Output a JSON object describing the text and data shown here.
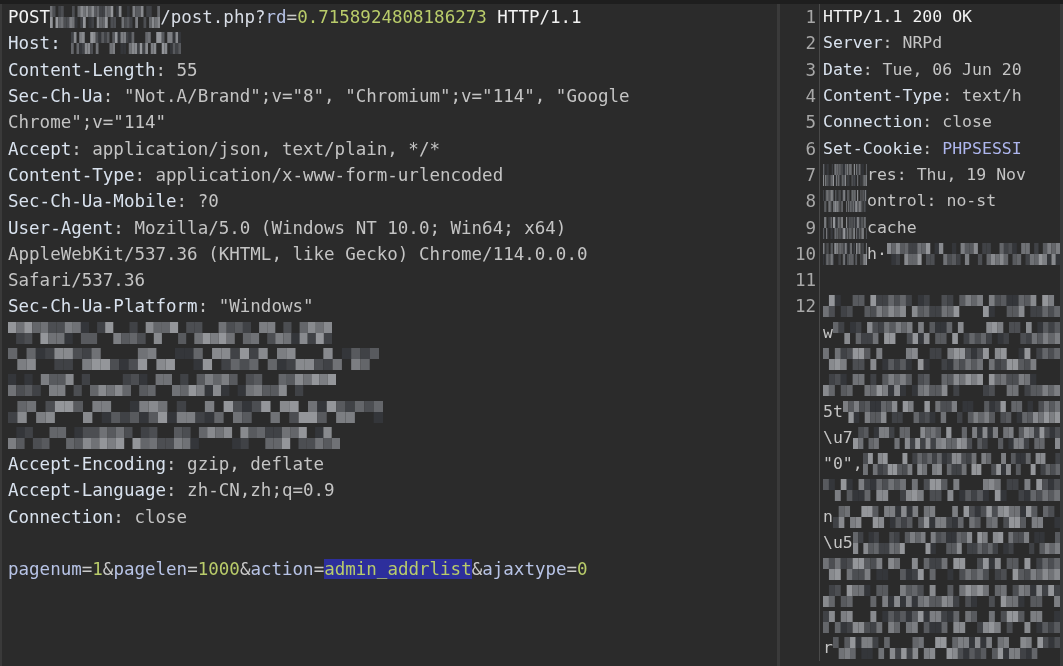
{
  "request": {
    "lines": [
      {
        "kind": "code",
        "segments": [
          {
            "t": "POST",
            "kind": "method"
          },
          {
            "kind": "redacted"
          },
          {
            "t": "/post.php?",
            "kind": "path"
          },
          {
            "t": "rd",
            "kind": "param"
          },
          {
            "t": "=",
            "kind": "plain"
          },
          {
            "t": "0.7158924808186273",
            "kind": "number"
          },
          {
            "t": " HTTP/1.1",
            "kind": "method"
          }
        ]
      },
      {
        "kind": "code",
        "segments": [
          {
            "t": "Host: ",
            "kind": "name"
          },
          {
            "kind": "redacted"
          }
        ]
      },
      {
        "kind": "code",
        "segments": [
          {
            "t": "Content-Length",
            "kind": "name"
          },
          {
            "t": ": 55",
            "kind": "value"
          }
        ]
      },
      {
        "kind": "code",
        "segments": [
          {
            "t": "Sec-Ch-Ua",
            "kind": "name"
          },
          {
            "t": ": \"Not.A/Brand\";v=\"8\", \"Chromium\";v=\"114\", \"Google",
            "kind": "value"
          }
        ]
      },
      {
        "kind": "code",
        "segments": [
          {
            "t": "Chrome\";v=\"114\"",
            "kind": "value"
          }
        ]
      },
      {
        "kind": "code",
        "segments": [
          {
            "t": "Accept",
            "kind": "name"
          },
          {
            "t": ": application/json, text/plain, */*",
            "kind": "value"
          }
        ]
      },
      {
        "kind": "code",
        "segments": [
          {
            "t": "Content-Type",
            "kind": "name"
          },
          {
            "t": ": application/x-www-form-urlencoded",
            "kind": "value"
          }
        ]
      },
      {
        "kind": "code",
        "segments": [
          {
            "t": "Sec-Ch-Ua-Mobile",
            "kind": "name"
          },
          {
            "t": ": ?0",
            "kind": "value"
          }
        ]
      },
      {
        "kind": "code",
        "segments": [
          {
            "t": "User-Agent",
            "kind": "name"
          },
          {
            "t": ": Mozilla/5.0 (Windows NT 10.0; Win64; x64)",
            "kind": "value"
          }
        ]
      },
      {
        "kind": "code",
        "segments": [
          {
            "t": "AppleWebKit/537.36 (KHTML, like Gecko) Chrome/114.0.0.0",
            "kind": "value"
          }
        ]
      },
      {
        "kind": "code",
        "segments": [
          {
            "t": "Safari/537.36",
            "kind": "value"
          }
        ]
      },
      {
        "kind": "code",
        "segments": [
          {
            "t": "Sec-Ch-Ua-Platform",
            "kind": "name"
          },
          {
            "t": ": \"Windows\"",
            "kind": "value"
          }
        ]
      },
      {
        "kind": "redacted"
      },
      {
        "kind": "redacted"
      },
      {
        "kind": "redacted"
      },
      {
        "kind": "redacted"
      },
      {
        "kind": "redacted"
      },
      {
        "kind": "code",
        "segments": [
          {
            "t": "Accept-Encoding",
            "kind": "name"
          },
          {
            "t": ": gzip, deflate",
            "kind": "value"
          }
        ]
      },
      {
        "kind": "code",
        "segments": [
          {
            "t": "Accept-Language",
            "kind": "name"
          },
          {
            "t": ": zh-CN,zh;q=0.9",
            "kind": "value"
          }
        ]
      },
      {
        "kind": "code",
        "segments": [
          {
            "t": "Connection",
            "kind": "name"
          },
          {
            "t": ": close",
            "kind": "value"
          }
        ]
      },
      {
        "kind": "blank"
      },
      {
        "kind": "code",
        "segments": [
          {
            "t": "pagenum",
            "kind": "param"
          },
          {
            "t": "=",
            "kind": "plain"
          },
          {
            "t": "1",
            "kind": "number"
          },
          {
            "t": "&",
            "kind": "plain"
          },
          {
            "t": "pagelen",
            "kind": "param"
          },
          {
            "t": "=",
            "kind": "plain"
          },
          {
            "t": "1000",
            "kind": "number"
          },
          {
            "t": "&",
            "kind": "plain"
          },
          {
            "t": "action",
            "kind": "param"
          },
          {
            "t": "=",
            "kind": "plain"
          },
          {
            "t": "admin_addrlist",
            "kind": "selected"
          },
          {
            "t": "&",
            "kind": "plain"
          },
          {
            "t": "ajaxtype",
            "kind": "param"
          },
          {
            "t": "=",
            "kind": "plain"
          },
          {
            "t": "0",
            "kind": "number"
          }
        ]
      }
    ]
  },
  "response": {
    "lines": [
      {
        "num": "1",
        "segments": [
          {
            "t": "HTTP/1.1 200 OK",
            "kind": "method"
          }
        ]
      },
      {
        "num": "2",
        "segments": [
          {
            "t": "Server",
            "kind": "name"
          },
          {
            "t": ": NRPd",
            "kind": "value"
          }
        ]
      },
      {
        "num": "3",
        "segments": [
          {
            "t": "Date",
            "kind": "name"
          },
          {
            "t": ": Tue, 06 Jun 20",
            "kind": "value"
          }
        ]
      },
      {
        "num": "4",
        "segments": [
          {
            "t": "Content-Type",
            "kind": "name"
          },
          {
            "t": ": text/h",
            "kind": "value"
          }
        ]
      },
      {
        "num": "5",
        "segments": [
          {
            "t": "Connection",
            "kind": "name"
          },
          {
            "t": ": close",
            "kind": "value"
          }
        ]
      },
      {
        "num": "6",
        "segments": [
          {
            "t": "Set-Cookie",
            "kind": "name"
          },
          {
            "t": ": ",
            "kind": "value"
          },
          {
            "t": "PHPSESSI",
            "kind": "cookie"
          }
        ]
      },
      {
        "num": "7",
        "segments": [
          {
            "kind": "redacted"
          },
          {
            "t": "res: Thu, 19 Nov",
            "kind": "value"
          }
        ]
      },
      {
        "num": "8",
        "segments": [
          {
            "kind": "redacted"
          },
          {
            "t": "ontrol: no-st",
            "kind": "value"
          }
        ]
      },
      {
        "num": "9",
        "segments": [
          {
            "kind": "redacted"
          },
          {
            "t": "cache",
            "kind": "value"
          }
        ]
      },
      {
        "num": "10",
        "segments": [
          {
            "kind": "redacted"
          },
          {
            "t": "h·",
            "kind": "value"
          },
          {
            "kind": "redacted"
          }
        ]
      },
      {
        "num": "11"
      },
      {
        "num": "12",
        "segments": [
          {
            "kind": "redacted"
          }
        ]
      },
      {
        "segments": [
          {
            "t": "w",
            "kind": "value"
          },
          {
            "kind": "redacted"
          }
        ]
      },
      {
        "segments": [
          {
            "kind": "redacted"
          }
        ]
      },
      {
        "segments": [
          {
            "kind": "redacted"
          }
        ]
      },
      {
        "segments": [
          {
            "t": "5t",
            "kind": "value"
          },
          {
            "kind": "redacted"
          }
        ]
      },
      {
        "segments": [
          {
            "t": "\\u7",
            "kind": "value"
          },
          {
            "kind": "redacted"
          }
        ]
      },
      {
        "segments": [
          {
            "t": "\"0\",",
            "kind": "value"
          },
          {
            "kind": "redacted"
          }
        ]
      },
      {
        "segments": [
          {
            "kind": "redacted"
          }
        ]
      },
      {
        "segments": [
          {
            "t": "n",
            "kind": "value"
          },
          {
            "kind": "redacted"
          }
        ]
      },
      {
        "segments": [
          {
            "t": "\\u5",
            "kind": "value"
          },
          {
            "kind": "redacted"
          }
        ]
      },
      {
        "segments": [
          {
            "kind": "redacted"
          }
        ]
      },
      {
        "segments": [
          {
            "kind": "redacted"
          }
        ]
      },
      {
        "segments": [
          {
            "kind": "redacted"
          }
        ]
      },
      {
        "segments": [
          {
            "t": "r",
            "kind": "value"
          },
          {
            "kind": "redacted"
          }
        ]
      }
    ]
  }
}
